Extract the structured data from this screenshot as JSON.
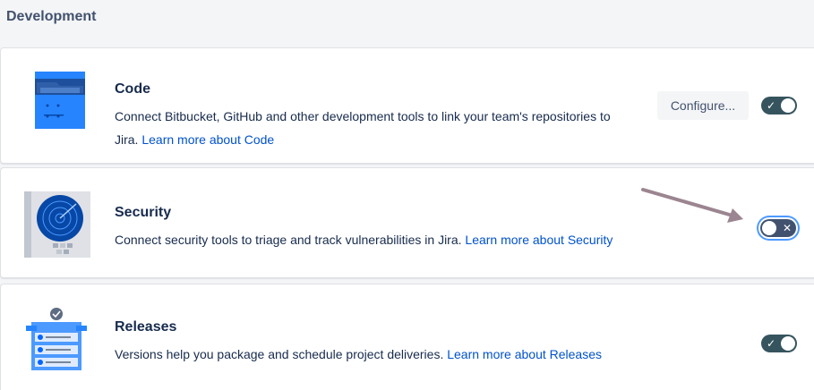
{
  "section": {
    "title": "Development"
  },
  "cards": [
    {
      "title": "Code",
      "desc_line1": "Connect Bitbucket, GitHub and other development tools to link your team's repositories to",
      "desc_line2": "Jira.",
      "link": "Learn more about Code",
      "configure_label": "Configure...",
      "enabled": true,
      "toggle_glyph": "✓"
    },
    {
      "title": "Security",
      "desc": "Connect security tools to triage and track vulnerabilities in Jira.",
      "link": "Learn more about Security",
      "enabled": false,
      "toggle_glyph": "✕"
    },
    {
      "title": "Releases",
      "desc": "Versions help you package and schedule project deliveries.",
      "link": "Learn more about Releases",
      "enabled": true,
      "toggle_glyph": "✓"
    }
  ],
  "colors": {
    "link": "#0052cc",
    "toggle_on": "#36545e",
    "toggle_off": "#42526e",
    "focus_ring": "#4c9aff",
    "annotation_arrow": "#9b8590"
  }
}
